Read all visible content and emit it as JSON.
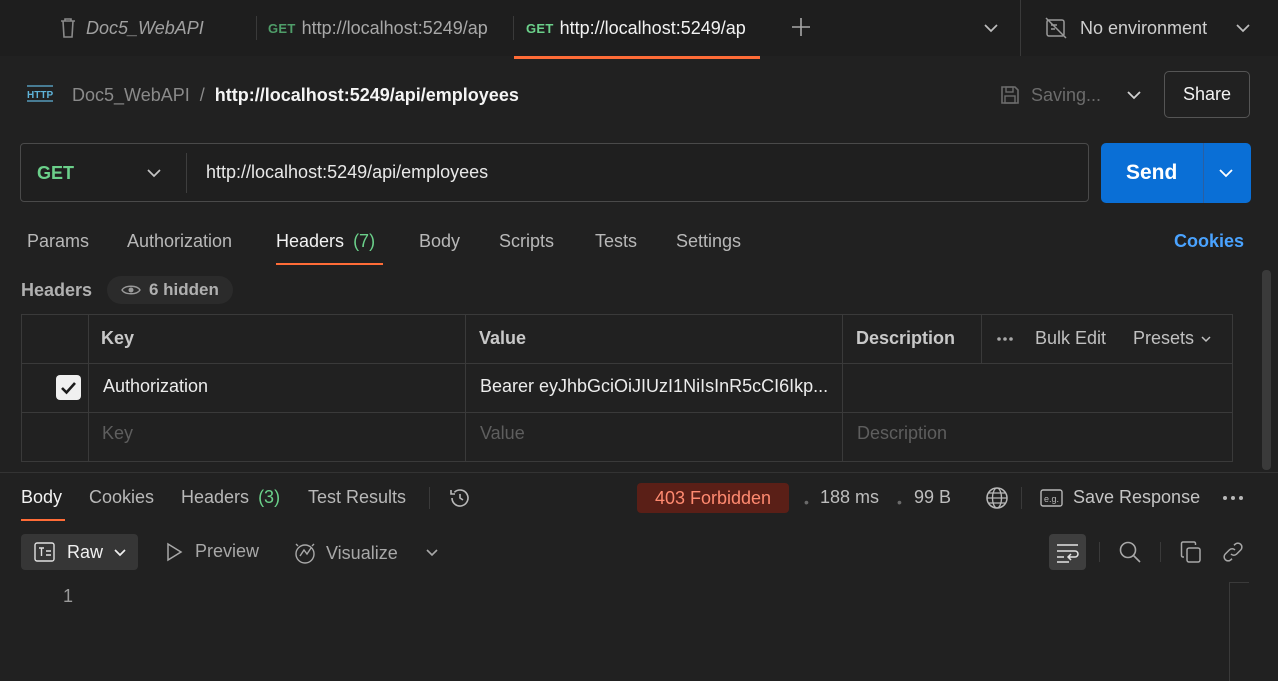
{
  "tabs": {
    "collection": "Doc5_WebAPI",
    "tab1": {
      "method": "GET",
      "url": "http://localhost:5249/ap"
    },
    "tab2": {
      "method": "GET",
      "url": "http://localhost:5249/ap"
    },
    "environment": "No environment"
  },
  "header": {
    "http_badge": "HTTP",
    "collection": "Doc5_WebAPI",
    "separator": "/",
    "title": "http://localhost:5249/api/employees",
    "saving": "Saving...",
    "share": "Share"
  },
  "request": {
    "method": "GET",
    "url": "http://localhost:5249/api/employees",
    "send": "Send"
  },
  "request_tabs": [
    {
      "label": "Params"
    },
    {
      "label": "Authorization"
    },
    {
      "label": "Headers",
      "count": "(7)"
    },
    {
      "label": "Body"
    },
    {
      "label": "Scripts"
    },
    {
      "label": "Tests"
    },
    {
      "label": "Settings"
    }
  ],
  "cookies_link": "Cookies",
  "headers_section": {
    "title": "Headers",
    "hidden": "6 hidden",
    "columns": {
      "key": "Key",
      "value": "Value",
      "description": "Description"
    },
    "bulk_edit": "Bulk Edit",
    "presets": "Presets",
    "rows": [
      {
        "key": "Authorization",
        "value": "Bearer eyJhbGciOiJIUzI1NiIsInR5cCI6Ikp...",
        "checked": true
      }
    ],
    "placeholders": {
      "key": "Key",
      "value": "Value",
      "description": "Description"
    }
  },
  "response": {
    "tabs": [
      {
        "label": "Body"
      },
      {
        "label": "Cookies"
      },
      {
        "label": "Headers",
        "count": "(3)"
      },
      {
        "label": "Test Results"
      }
    ],
    "status": "403 Forbidden",
    "time": "188 ms",
    "size": "99 B",
    "save_response": "Save Response",
    "format": "Raw",
    "preview": "Preview",
    "visualize": "Visualize",
    "line_numbers": [
      "1"
    ]
  },
  "colors": {
    "accent": "#ff6c37",
    "send": "#0a6fd6",
    "method_get": "#6bd08a",
    "status_error_bg": "#5a1f17",
    "status_error_text": "#ff8a70",
    "link": "#4aa3ff"
  }
}
